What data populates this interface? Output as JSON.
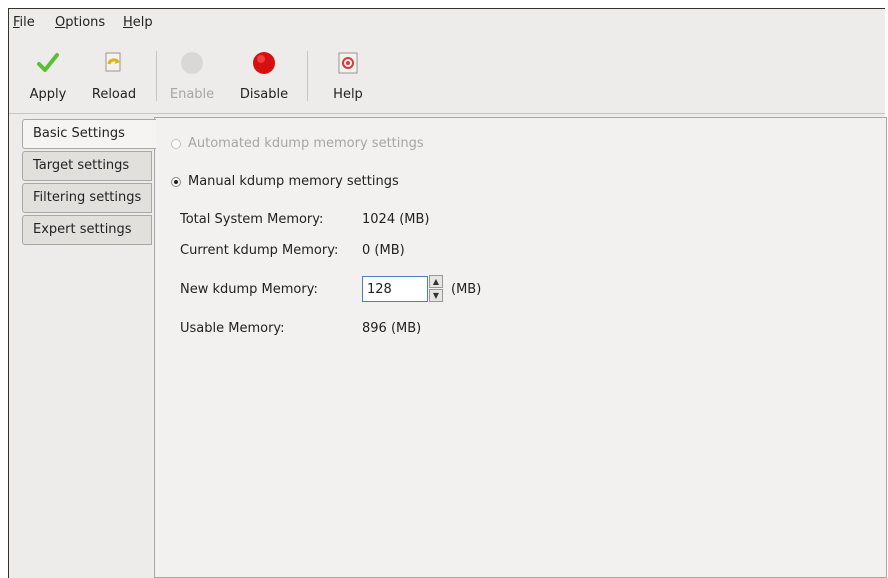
{
  "menubar": {
    "file": {
      "mnemonic": "F",
      "rest": "ile"
    },
    "options": {
      "mnemonic": "O",
      "rest": "ptions"
    },
    "help": {
      "mnemonic": "H",
      "rest": "elp"
    }
  },
  "toolbar": {
    "apply": {
      "label": "Apply",
      "icon": "checkmark-icon",
      "color": "#4caf2e"
    },
    "reload": {
      "label": "Reload",
      "icon": "reload-icon"
    },
    "enable": {
      "label": "Enable",
      "icon": "enable-icon",
      "disabled": true
    },
    "disable": {
      "label": "Disable",
      "icon": "disable-icon",
      "color": "#d61010"
    },
    "help": {
      "label": "Help",
      "icon": "help-icon"
    }
  },
  "tabs": [
    {
      "label": "Basic Settings",
      "active": true
    },
    {
      "label": "Target settings"
    },
    {
      "label": "Filtering settings"
    },
    {
      "label": "Expert settings"
    }
  ],
  "basic": {
    "automated_label": "Automated kdump memory settings",
    "manual_label": "Manual kdump memory settings",
    "selected": "manual",
    "total_label": "Total System Memory:",
    "total_value": "1024 (MB)",
    "current_label": "Current kdump Memory:",
    "current_value": "0 (MB)",
    "new_label": "New kdump Memory:",
    "new_value": "128",
    "new_unit": "(MB)",
    "usable_label": "Usable Memory:",
    "usable_value": "896 (MB)"
  }
}
